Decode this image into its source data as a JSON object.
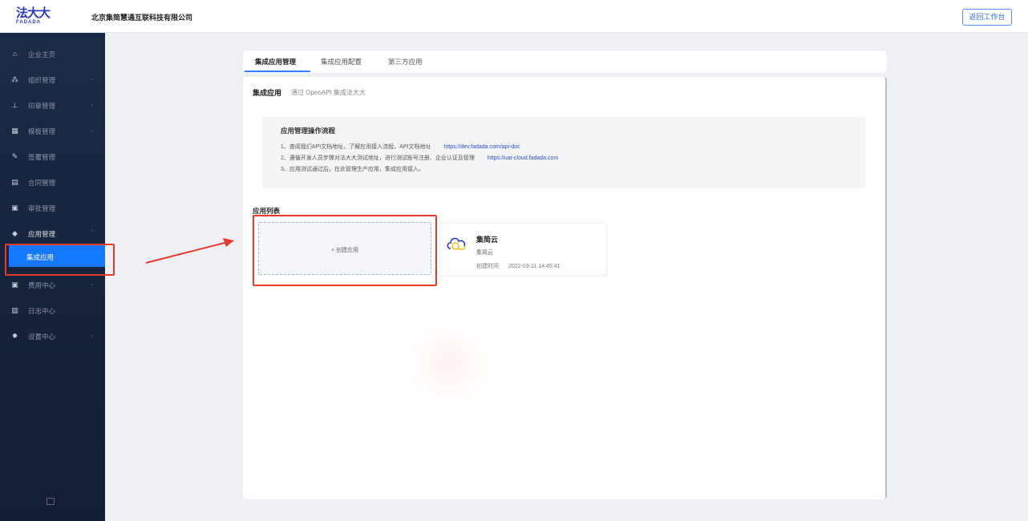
{
  "header": {
    "logo_main": "法大大",
    "logo_sub": "FADADA",
    "company": "北京集简慧通互联科技有限公司",
    "back_button": "返回工作台"
  },
  "sidebar": {
    "items": [
      {
        "label": "企业主页",
        "icon": "home-icon",
        "has_chevron": false
      },
      {
        "label": "组织管理",
        "icon": "org-icon",
        "has_chevron": true
      },
      {
        "label": "印章管理",
        "icon": "seal-icon",
        "has_chevron": true
      },
      {
        "label": "模板管理",
        "icon": "template-icon",
        "has_chevron": true
      },
      {
        "label": "签署管理",
        "icon": "sign-icon",
        "has_chevron": false
      },
      {
        "label": "合同管理",
        "icon": "contract-icon",
        "has_chevron": false
      },
      {
        "label": "审批管理",
        "icon": "approval-icon",
        "has_chevron": false
      },
      {
        "label": "应用管理",
        "icon": "app-icon",
        "has_chevron": true,
        "expanded": true
      },
      {
        "label": "费用中心",
        "icon": "billing-icon",
        "has_chevron": true
      },
      {
        "label": "日志中心",
        "icon": "log-icon",
        "has_chevron": false
      },
      {
        "label": "设置中心",
        "icon": "settings-icon",
        "has_chevron": true
      }
    ],
    "sub_item": {
      "label": "集成应用",
      "active": true
    },
    "collapse_icon": "collapse-icon"
  },
  "tabs": [
    {
      "label": "集成应用管理",
      "active": true
    },
    {
      "label": "集成应用配置",
      "active": false
    },
    {
      "label": "第三方应用",
      "active": false
    }
  ],
  "section": {
    "title": "集成应用",
    "subtitle": "通过 OpenAPI 集成法大大"
  },
  "info": {
    "title": "应用管理操作流程",
    "lines": [
      {
        "text": "1、查阅我们API文档地址，了解应用接入流程，API文档地址",
        "link": "https://dev.fadada.com/api-doc"
      },
      {
        "text": "2、遵循开发人员步骤对法大大测试地址，进行测试账号注册、企业认证及管理",
        "link": "https://uat-cloud.fadada.com"
      },
      {
        "text": "3、应用测试通过后，在此管理生产应用，集成应用接入。",
        "link": ""
      }
    ]
  },
  "app_list": {
    "title": "应用列表",
    "create_label": "+ 创建应用",
    "apps": [
      {
        "name": "集简云",
        "tag": "集简云",
        "created_label": "创建时间",
        "created_time": "2022-03-11 14:45:41",
        "icon": "cloud-logo-icon"
      }
    ]
  },
  "colors": {
    "accent": "#1677ff",
    "highlight": "#e63a2e",
    "sidebar_bg": "#1d2a45",
    "link": "#2a4dd0"
  }
}
